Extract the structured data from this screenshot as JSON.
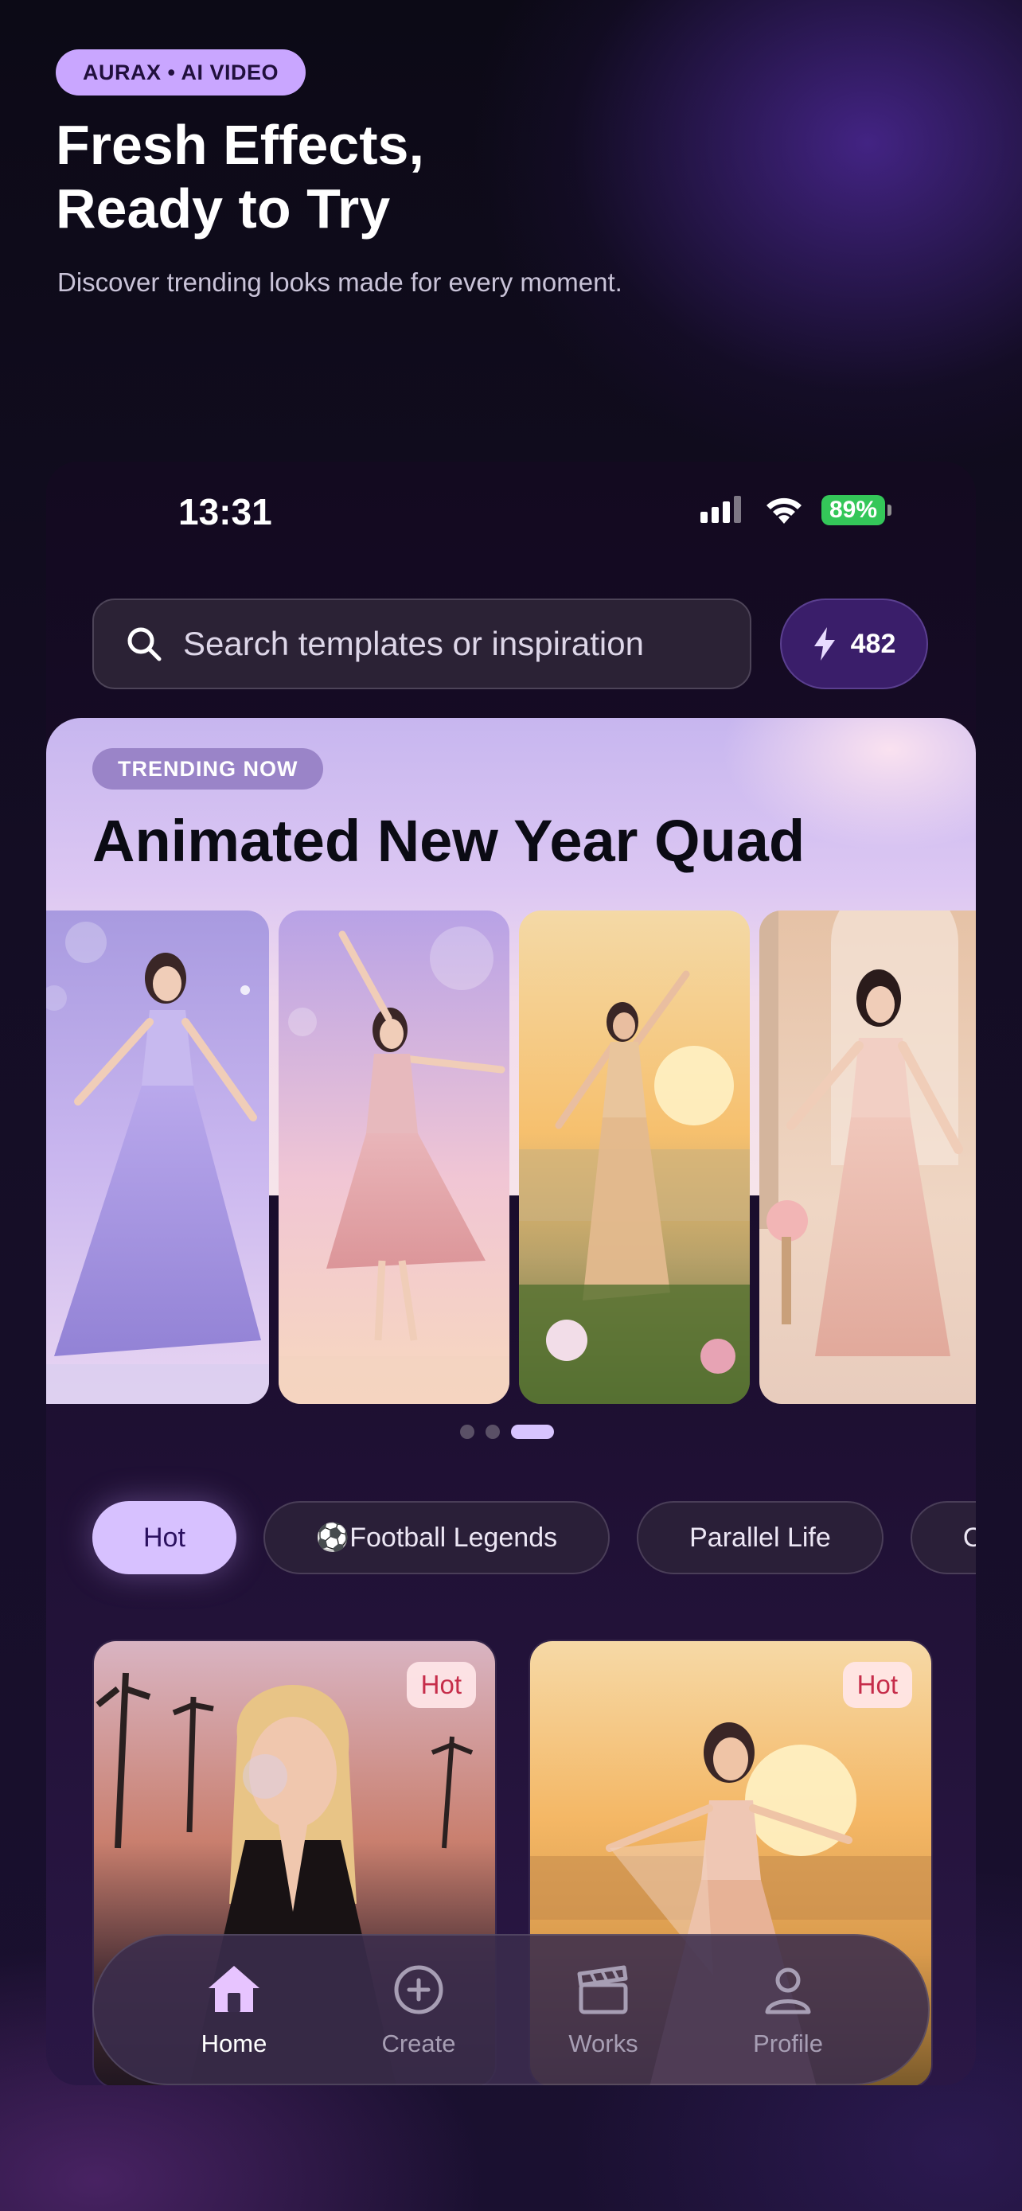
{
  "header": {
    "badge": "AURAX • AI VIDEO",
    "title_line1": "Fresh Effects,",
    "title_line2": "Ready to Try",
    "subtitle": "Discover trending looks made for every moment."
  },
  "status_bar": {
    "time": "13:31",
    "battery": "89%"
  },
  "search": {
    "placeholder": "Search templates or inspiration",
    "search_icon": "search-icon"
  },
  "credits": {
    "icon": "lightning-icon",
    "count": "482"
  },
  "hero": {
    "badge": "TRENDING NOW",
    "title": "Animated New Year Quad",
    "pager_count": 3,
    "active_page": 3
  },
  "chips": [
    {
      "label": "Hot",
      "active": true
    },
    {
      "label": "⚽Football Legends",
      "active": false
    },
    {
      "label": "Parallel Life",
      "active": false
    },
    {
      "label": "Co",
      "active": false
    }
  ],
  "grid": [
    {
      "tag": "Hot"
    },
    {
      "tag": "Hot"
    }
  ],
  "nav": {
    "home": "Home",
    "create": "Create",
    "works": "Works",
    "profile": "Profile"
  },
  "colors": {
    "accent": "#d7c1ff",
    "badge": "#c9a6ff",
    "hot_text": "#c62d4a",
    "battery": "#34c759"
  }
}
